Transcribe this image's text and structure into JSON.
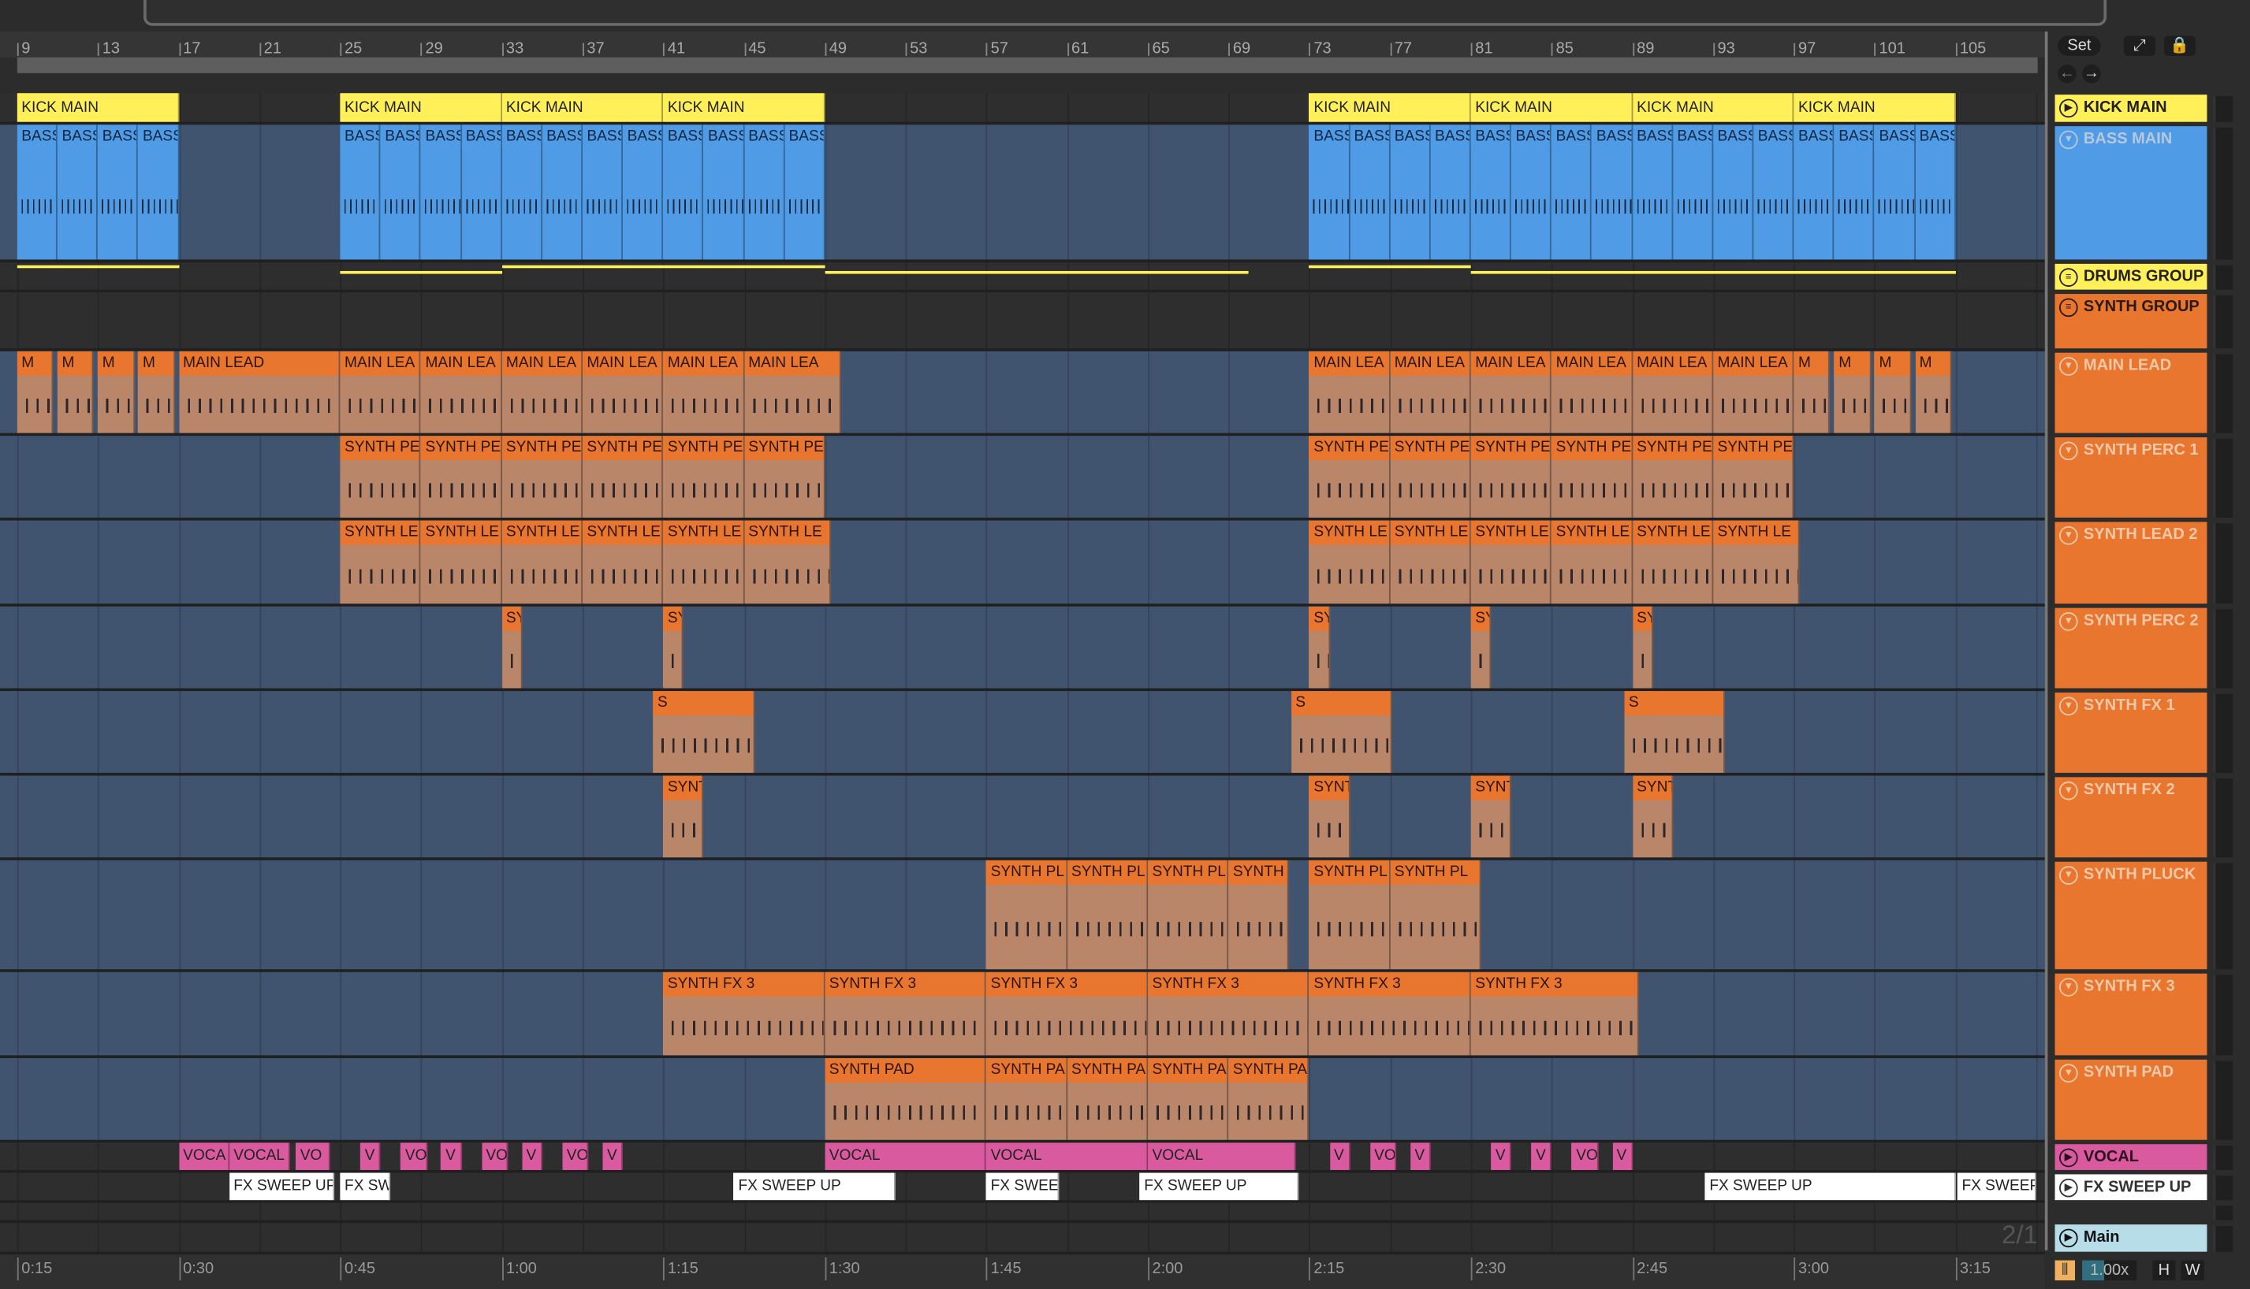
{
  "ruler": {
    "bars": [
      "9",
      "13",
      "17",
      "21",
      "25",
      "29",
      "33",
      "37",
      "41",
      "45",
      "49",
      "53",
      "57",
      "61",
      "65",
      "69",
      "73",
      "77",
      "81",
      "85",
      "89",
      "93",
      "97",
      "101",
      "105"
    ]
  },
  "time_ruler": [
    "0:15",
    "0:30",
    "0:45",
    "1:00",
    "1:15",
    "1:30",
    "1:45",
    "2:00",
    "2:15",
    "2:30",
    "2:45",
    "3:00",
    "3:15"
  ],
  "controls": {
    "set_label": "Set",
    "zoom_value": "1.00x",
    "h_label": "H",
    "w_label": "W",
    "page_indicator": "2/1"
  },
  "colors": {
    "yellow": "#fff05a",
    "blue": "#4f9be6",
    "orange": "#e8762f",
    "pink": "#d95a9e",
    "white": "#ffffff",
    "lightblue": "#b6dde8"
  },
  "tracks": [
    {
      "name": "KICK MAIN",
      "icon": "play",
      "color": "#fff05a",
      "textColor": "#222",
      "clips": [
        {
          "label": "KICK MAIN",
          "start": 9,
          "end": 17
        },
        {
          "label": "KICK MAIN",
          "start": 25,
          "end": 33
        },
        {
          "label": "KICK MAIN",
          "start": 33,
          "end": 41
        },
        {
          "label": "KICK MAIN",
          "start": 41,
          "end": 49
        },
        {
          "label": "KICK MAIN",
          "start": 73,
          "end": 81
        },
        {
          "label": "KICK MAIN",
          "start": 81,
          "end": 89
        },
        {
          "label": "KICK MAIN",
          "start": 89,
          "end": 97
        },
        {
          "label": "KICK MAIN",
          "start": 97,
          "end": 105
        }
      ]
    },
    {
      "name": "BASS MAIN",
      "icon": "down",
      "color": "#4f9be6",
      "textColor": "#b8c8dc",
      "clips": [
        {
          "label": "BASS",
          "start": 9,
          "end": 11
        },
        {
          "label": "BASS",
          "start": 11,
          "end": 13
        },
        {
          "label": "BASS",
          "start": 13,
          "end": 15
        },
        {
          "label": "BASS",
          "start": 15,
          "end": 17
        },
        {
          "label": "BASS",
          "start": 25,
          "end": 27
        },
        {
          "label": "BASS",
          "start": 27,
          "end": 29
        },
        {
          "label": "BASS",
          "start": 29,
          "end": 31
        },
        {
          "label": "BASS",
          "start": 31,
          "end": 33
        },
        {
          "label": "BASS",
          "start": 33,
          "end": 35
        },
        {
          "label": "BASS",
          "start": 35,
          "end": 37
        },
        {
          "label": "BASS",
          "start": 37,
          "end": 39
        },
        {
          "label": "BASS",
          "start": 39,
          "end": 41
        },
        {
          "label": "BASS",
          "start": 41,
          "end": 43
        },
        {
          "label": "BASS",
          "start": 43,
          "end": 45
        },
        {
          "label": "BASS",
          "start": 45,
          "end": 47
        },
        {
          "label": "BASS",
          "start": 47,
          "end": 49
        },
        {
          "label": "BASS",
          "start": 73,
          "end": 75
        },
        {
          "label": "BASS",
          "start": 75,
          "end": 77
        },
        {
          "label": "BASS",
          "start": 77,
          "end": 79
        },
        {
          "label": "BASS",
          "start": 79,
          "end": 81
        },
        {
          "label": "BASS",
          "start": 81,
          "end": 83
        },
        {
          "label": "BASS",
          "start": 83,
          "end": 85
        },
        {
          "label": "BASS",
          "start": 85,
          "end": 87
        },
        {
          "label": "BASS",
          "start": 87,
          "end": 89
        },
        {
          "label": "BASS",
          "start": 89,
          "end": 91
        },
        {
          "label": "BASS",
          "start": 91,
          "end": 93
        },
        {
          "label": "BASS",
          "start": 93,
          "end": 95
        },
        {
          "label": "BASS",
          "start": 95,
          "end": 97
        },
        {
          "label": "BASS",
          "start": 97,
          "end": 99
        },
        {
          "label": "BASS",
          "start": 99,
          "end": 101
        },
        {
          "label": "BASS",
          "start": 101,
          "end": 103
        },
        {
          "label": "BASS",
          "start": 103,
          "end": 105
        }
      ]
    },
    {
      "name": "DRUMS GROUP",
      "icon": "group",
      "color": "#fff05a",
      "textColor": "#222",
      "clips": []
    },
    {
      "name": "SYNTH GROUP",
      "icon": "group",
      "color": "#e8762f",
      "textColor": "#2a1a10",
      "clips": []
    },
    {
      "name": "MAIN LEAD",
      "icon": "down",
      "color": "#e8762f",
      "textColor": "#f3c8a8",
      "clips": [
        {
          "label": "M",
          "start": 9,
          "end": 10.8
        },
        {
          "label": "M",
          "start": 11,
          "end": 12.8
        },
        {
          "label": "M",
          "start": 13,
          "end": 14.8
        },
        {
          "label": "M",
          "start": 15,
          "end": 16.8
        },
        {
          "label": "MAIN LEAD",
          "start": 17,
          "end": 25
        },
        {
          "label": "MAIN LEA",
          "start": 25,
          "end": 29
        },
        {
          "label": "MAIN LEA",
          "start": 29,
          "end": 33
        },
        {
          "label": "MAIN LEA",
          "start": 33,
          "end": 37
        },
        {
          "label": "MAIN LEA",
          "start": 37,
          "end": 41
        },
        {
          "label": "MAIN LEA",
          "start": 41,
          "end": 45
        },
        {
          "label": "MAIN LEA",
          "start": 45,
          "end": 49.8
        },
        {
          "label": "MAIN LEA",
          "start": 73,
          "end": 77
        },
        {
          "label": "MAIN LEA",
          "start": 77,
          "end": 81
        },
        {
          "label": "MAIN LEA",
          "start": 81,
          "end": 85
        },
        {
          "label": "MAIN LEA",
          "start": 85,
          "end": 89
        },
        {
          "label": "MAIN LEA",
          "start": 89,
          "end": 93
        },
        {
          "label": "MAIN LEA",
          "start": 93,
          "end": 97
        },
        {
          "label": "M",
          "start": 97,
          "end": 98.8
        },
        {
          "label": "M",
          "start": 99,
          "end": 100.8
        },
        {
          "label": "M",
          "start": 101,
          "end": 102.8
        },
        {
          "label": "M",
          "start": 103,
          "end": 104.8
        }
      ]
    },
    {
      "name": "SYNTH PERC 1",
      "icon": "down",
      "color": "#e8762f",
      "textColor": "#f3c8a8",
      "clips": [
        {
          "label": "SYNTH PE",
          "start": 25,
          "end": 29
        },
        {
          "label": "SYNTH PE",
          "start": 29,
          "end": 33
        },
        {
          "label": "SYNTH PE",
          "start": 33,
          "end": 37
        },
        {
          "label": "SYNTH PE",
          "start": 37,
          "end": 41
        },
        {
          "label": "SYNTH PE",
          "start": 41,
          "end": 45
        },
        {
          "label": "SYNTH PE",
          "start": 45,
          "end": 49
        },
        {
          "label": "SYNTH PE",
          "start": 73,
          "end": 77
        },
        {
          "label": "SYNTH PE",
          "start": 77,
          "end": 81
        },
        {
          "label": "SYNTH PE",
          "start": 81,
          "end": 85
        },
        {
          "label": "SYNTH PE",
          "start": 85,
          "end": 89
        },
        {
          "label": "SYNTH PE",
          "start": 89,
          "end": 93
        },
        {
          "label": "SYNTH PE",
          "start": 93,
          "end": 97
        }
      ]
    },
    {
      "name": "SYNTH LEAD 2",
      "icon": "down",
      "color": "#e8762f",
      "textColor": "#f3c8a8",
      "clips": [
        {
          "label": "SYNTH LE",
          "start": 25,
          "end": 29
        },
        {
          "label": "SYNTH LE",
          "start": 29,
          "end": 33
        },
        {
          "label": "SYNTH LE",
          "start": 33,
          "end": 37
        },
        {
          "label": "SYNTH LE",
          "start": 37,
          "end": 41
        },
        {
          "label": "SYNTH LE",
          "start": 41,
          "end": 45
        },
        {
          "label": "SYNTH LE",
          "start": 45,
          "end": 49.3
        },
        {
          "label": "SYNTH LE",
          "start": 73,
          "end": 77
        },
        {
          "label": "SYNTH LE",
          "start": 77,
          "end": 81
        },
        {
          "label": "SYNTH LE",
          "start": 81,
          "end": 85
        },
        {
          "label": "SYNTH LE",
          "start": 85,
          "end": 89
        },
        {
          "label": "SYNTH LE",
          "start": 89,
          "end": 93
        },
        {
          "label": "SYNTH LE",
          "start": 93,
          "end": 97.3
        }
      ]
    },
    {
      "name": "SYNTH PERC 2",
      "icon": "down",
      "color": "#e8762f",
      "textColor": "#f3c8a8",
      "clips": [
        {
          "label": "SY",
          "start": 33,
          "end": 34
        },
        {
          "label": "SY",
          "start": 41,
          "end": 42
        },
        {
          "label": "SY",
          "start": 73,
          "end": 74
        },
        {
          "label": "SY",
          "start": 81,
          "end": 82
        },
        {
          "label": "SY",
          "start": 89,
          "end": 90
        }
      ]
    },
    {
      "name": "SYNTH FX 1",
      "icon": "down",
      "color": "#e8762f",
      "textColor": "#f3c8a8",
      "clips": [
        {
          "label": "S",
          "start": 40.5,
          "end": 45.5
        },
        {
          "label": "S",
          "start": 72.1,
          "end": 77.1
        },
        {
          "label": "S",
          "start": 88.6,
          "end": 93.6
        }
      ]
    },
    {
      "name": "SYNTH FX 2",
      "icon": "down",
      "color": "#e8762f",
      "textColor": "#f3c8a8",
      "clips": [
        {
          "label": "SYNT",
          "start": 41,
          "end": 43
        },
        {
          "label": "SYNT",
          "start": 73,
          "end": 75
        },
        {
          "label": "SYNT",
          "start": 81,
          "end": 83
        },
        {
          "label": "SYNT",
          "start": 89,
          "end": 91
        }
      ]
    },
    {
      "name": "SYNTH PLUCK",
      "icon": "down",
      "color": "#e8762f",
      "textColor": "#f3c8a8",
      "clips": [
        {
          "label": "SYNTH PL",
          "start": 57,
          "end": 61
        },
        {
          "label": "SYNTH PL",
          "start": 61,
          "end": 65
        },
        {
          "label": "SYNTH PL",
          "start": 65,
          "end": 69
        },
        {
          "label": "SYNTH",
          "start": 69,
          "end": 72
        },
        {
          "label": "SYNTH PL",
          "start": 73,
          "end": 77
        },
        {
          "label": "SYNTH PL",
          "start": 77,
          "end": 81.5
        }
      ]
    },
    {
      "name": "SYNTH FX 3",
      "icon": "down",
      "color": "#e8762f",
      "textColor": "#f3c8a8",
      "clips": [
        {
          "label": "SYNTH FX 3",
          "start": 41,
          "end": 49
        },
        {
          "label": "SYNTH FX 3",
          "start": 49,
          "end": 57
        },
        {
          "label": "SYNTH FX 3",
          "start": 57,
          "end": 65
        },
        {
          "label": "SYNTH FX 3",
          "start": 65,
          "end": 73
        },
        {
          "label": "SYNTH FX 3",
          "start": 73,
          "end": 81
        },
        {
          "label": "SYNTH FX 3",
          "start": 81,
          "end": 89.3
        }
      ]
    },
    {
      "name": "SYNTH PAD",
      "icon": "down",
      "color": "#e8762f",
      "textColor": "#f3c8a8",
      "clips": [
        {
          "label": "SYNTH PAD",
          "start": 49,
          "end": 57
        },
        {
          "label": "SYNTH PA",
          "start": 57,
          "end": 61
        },
        {
          "label": "SYNTH PA",
          "start": 61,
          "end": 65
        },
        {
          "label": "SYNTH PA",
          "start": 65,
          "end": 69
        },
        {
          "label": "SYNTH PA",
          "start": 69,
          "end": 73
        }
      ]
    },
    {
      "name": "VOCAL",
      "icon": "play",
      "color": "#d95a9e",
      "textColor": "#2a1020",
      "clips": [
        {
          "label": "VOCA",
          "start": 17,
          "end": 19.5
        },
        {
          "label": "VOCAL",
          "start": 19.5,
          "end": 22.5
        },
        {
          "label": "VO",
          "start": 22.8,
          "end": 24.5
        },
        {
          "label": "V",
          "start": 26,
          "end": 27
        },
        {
          "label": "VO",
          "start": 28,
          "end": 29.3
        },
        {
          "label": "V",
          "start": 30,
          "end": 31
        },
        {
          "label": "VO",
          "start": 32,
          "end": 33.3
        },
        {
          "label": "V",
          "start": 34,
          "end": 35
        },
        {
          "label": "VO",
          "start": 36,
          "end": 37.3
        },
        {
          "label": "V",
          "start": 38,
          "end": 39
        },
        {
          "label": "VOCAL",
          "start": 49,
          "end": 57
        },
        {
          "label": "VOCAL",
          "start": 57,
          "end": 65
        },
        {
          "label": "VOCAL",
          "start": 65,
          "end": 72.3
        },
        {
          "label": "V",
          "start": 74,
          "end": 75
        },
        {
          "label": "VO",
          "start": 76,
          "end": 77.3
        },
        {
          "label": "V",
          "start": 78,
          "end": 79
        },
        {
          "label": "V",
          "start": 82,
          "end": 83
        },
        {
          "label": "V",
          "start": 84,
          "end": 85
        },
        {
          "label": "VO",
          "start": 86,
          "end": 87.3
        },
        {
          "label": "V",
          "start": 88,
          "end": 89
        }
      ]
    },
    {
      "name": "FX SWEEP UP",
      "icon": "play",
      "color": "#ffffff",
      "textColor": "#333",
      "clips": [
        {
          "label": "FX SWEEP UP",
          "start": 19.5,
          "end": 24.7
        },
        {
          "label": "FX SW",
          "start": 25,
          "end": 27.5
        },
        {
          "label": "FX SWEEP UP",
          "start": 44.5,
          "end": 52.5
        },
        {
          "label": "FX SWEE",
          "start": 57,
          "end": 60.6
        },
        {
          "label": "FX SWEEP UP",
          "start": 64.6,
          "end": 72.5
        },
        {
          "label": "FX SWEEP UP",
          "start": 92.6,
          "end": 105
        },
        {
          "label": "FX SWEEP",
          "start": 105.1,
          "end": 109
        }
      ]
    },
    {
      "name": "",
      "icon": "",
      "color": "#333",
      "textColor": "#333",
      "clips": []
    },
    {
      "name": "Main",
      "icon": "play",
      "color": "#b6dde8",
      "textColor": "#111",
      "clips": []
    }
  ]
}
